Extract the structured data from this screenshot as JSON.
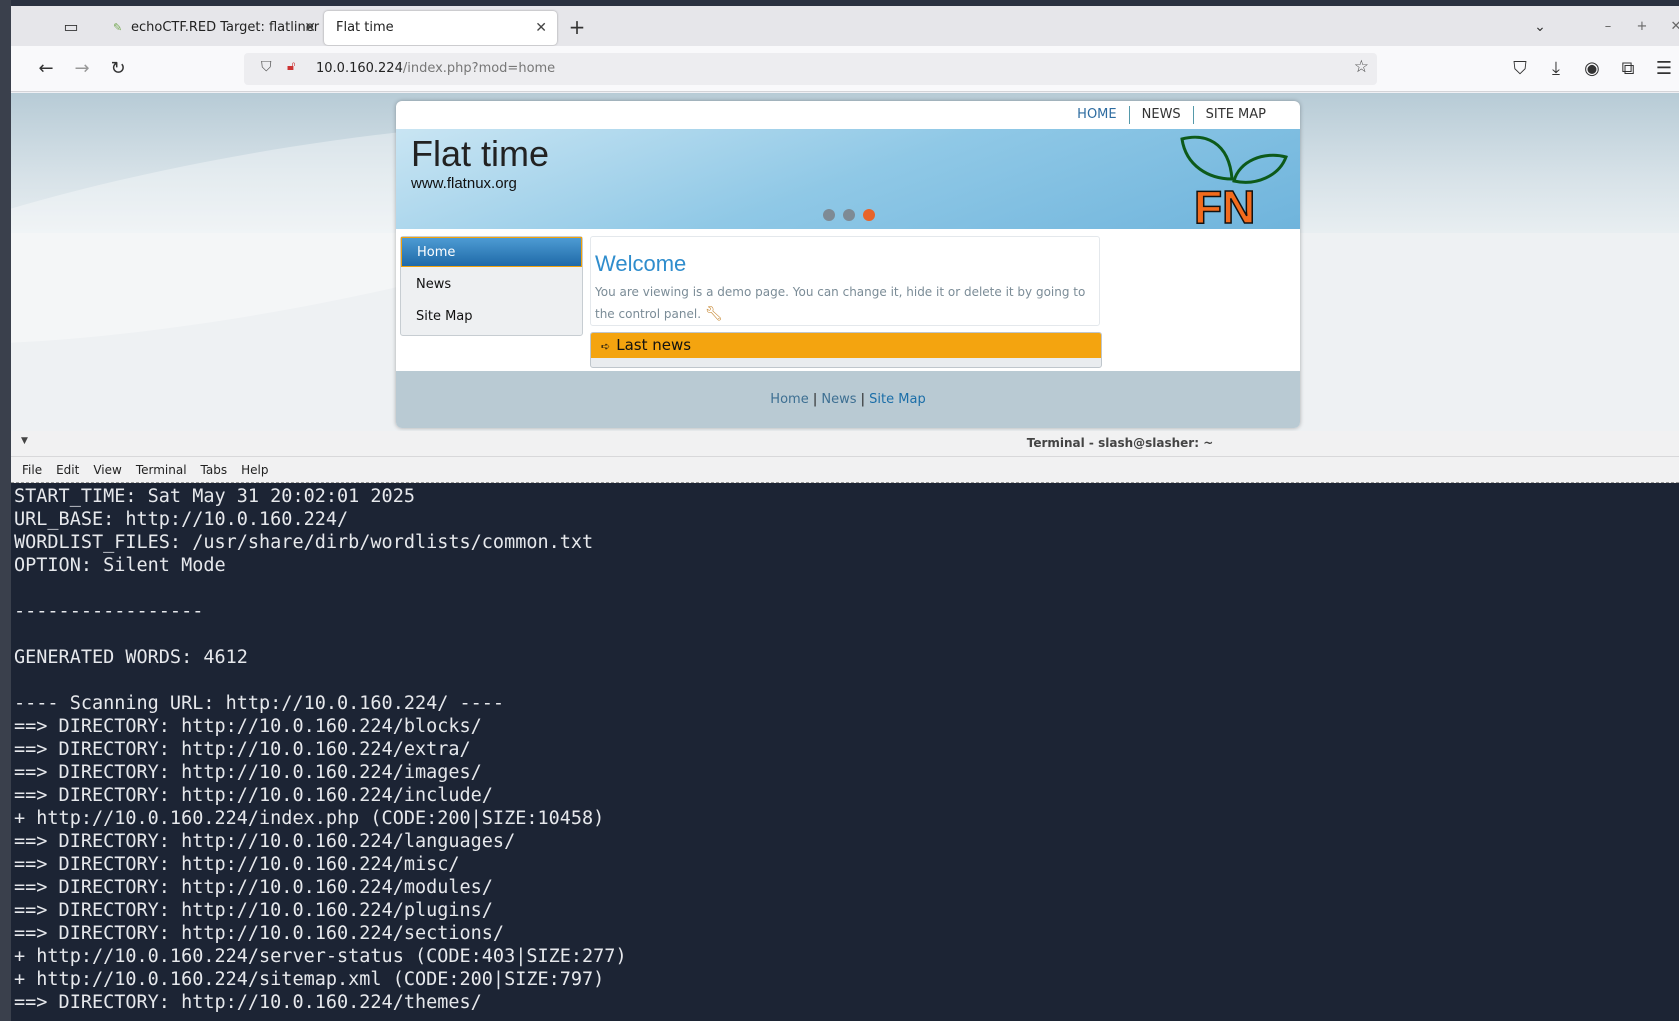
{
  "browser": {
    "tabs": [
      {
        "title": "echoCTF.RED Target: flatliner",
        "active": false
      },
      {
        "title": "Flat time",
        "active": true
      }
    ],
    "url_host": "10.0.160.224",
    "url_path": "/index.php?mod=home"
  },
  "site": {
    "topnav": [
      "HOME",
      "NEWS",
      "SITE MAP"
    ],
    "title": "Flat time",
    "url": "www.flatnux.org",
    "logo_text": "FN",
    "menu": [
      "Home",
      "News",
      "Site Map"
    ],
    "welcome": {
      "title": "Welcome",
      "text": "You are viewing is a demo page. You can change it, hide it or delete it by going to the control panel."
    },
    "lastnews_title": "Last news",
    "footer": [
      "Home",
      "News",
      "Site Map"
    ]
  },
  "terminal": {
    "title": "Terminal - slash@slasher: ~",
    "menu": [
      "File",
      "Edit",
      "View",
      "Terminal",
      "Tabs",
      "Help"
    ],
    "lines": [
      "START_TIME: Sat May 31 20:02:01 2025",
      "URL_BASE: http://10.0.160.224/",
      "WORDLIST_FILES: /usr/share/dirb/wordlists/common.txt",
      "OPTION: Silent Mode",
      "",
      "-----------------",
      "",
      "GENERATED WORDS: 4612",
      "",
      "---- Scanning URL: http://10.0.160.224/ ----",
      "==> DIRECTORY: http://10.0.160.224/blocks/",
      "==> DIRECTORY: http://10.0.160.224/extra/",
      "==> DIRECTORY: http://10.0.160.224/images/",
      "==> DIRECTORY: http://10.0.160.224/include/",
      "+ http://10.0.160.224/index.php (CODE:200|SIZE:10458)",
      "==> DIRECTORY: http://10.0.160.224/languages/",
      "==> DIRECTORY: http://10.0.160.224/misc/",
      "==> DIRECTORY: http://10.0.160.224/modules/",
      "==> DIRECTORY: http://10.0.160.224/plugins/",
      "==> DIRECTORY: http://10.0.160.224/sections/",
      "+ http://10.0.160.224/server-status (CODE:403|SIZE:277)",
      "+ http://10.0.160.224/sitemap.xml (CODE:200|SIZE:797)",
      "==> DIRECTORY: http://10.0.160.224/themes/"
    ]
  },
  "colors": {
    "accent_orange": "#f4a40f",
    "link_blue": "#2f8dcd",
    "terminal_bg": "#1c2434",
    "slider_active": "#e8642a"
  }
}
